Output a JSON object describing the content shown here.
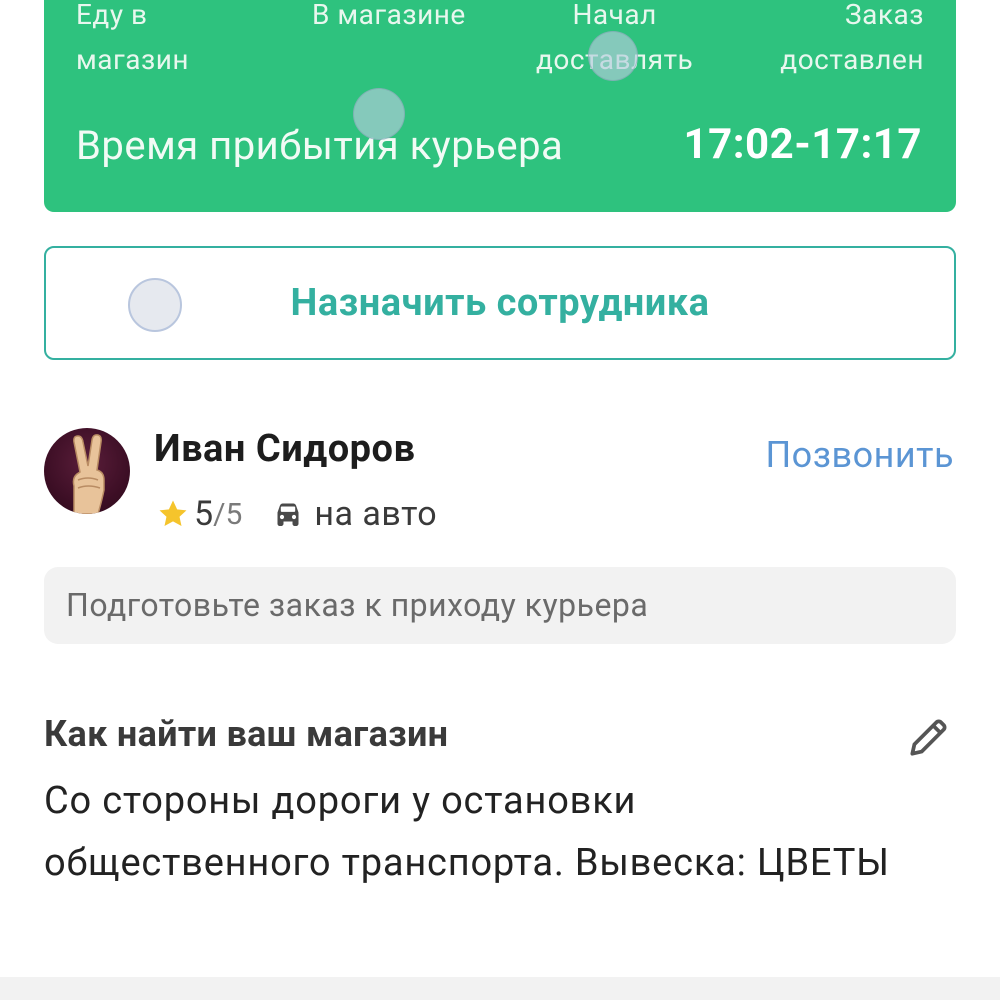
{
  "status": {
    "steps": [
      {
        "line1": "Еду в",
        "line2": "магазин"
      },
      {
        "line1": "В магазине",
        "line2": ""
      },
      {
        "line1": "Начал",
        "line2": "доставлять"
      },
      {
        "line1": "Заказ",
        "line2": "доставлен"
      }
    ],
    "eta_label": "Время прибытия курьера",
    "eta_time": "17:02-17:17",
    "color": "#2ec27e"
  },
  "assign_button": {
    "label": "Назначить сотрудника",
    "color": "#34b0a0"
  },
  "courier": {
    "name": "Иван Сидоров",
    "call_label": "Позвонить",
    "rating": "5",
    "rating_max": "/5",
    "transport": "на авто",
    "icons": [
      "star-icon",
      "car-icon"
    ]
  },
  "hint": {
    "text": "Подготовьте заказ к приходу курьера"
  },
  "store_directions": {
    "title": "Как найти ваш магазин",
    "text": "Со стороны дороги у остановки общественного транспорта. Вывеска: ЦВЕТЫ",
    "edit_icon": "pencil-icon"
  }
}
